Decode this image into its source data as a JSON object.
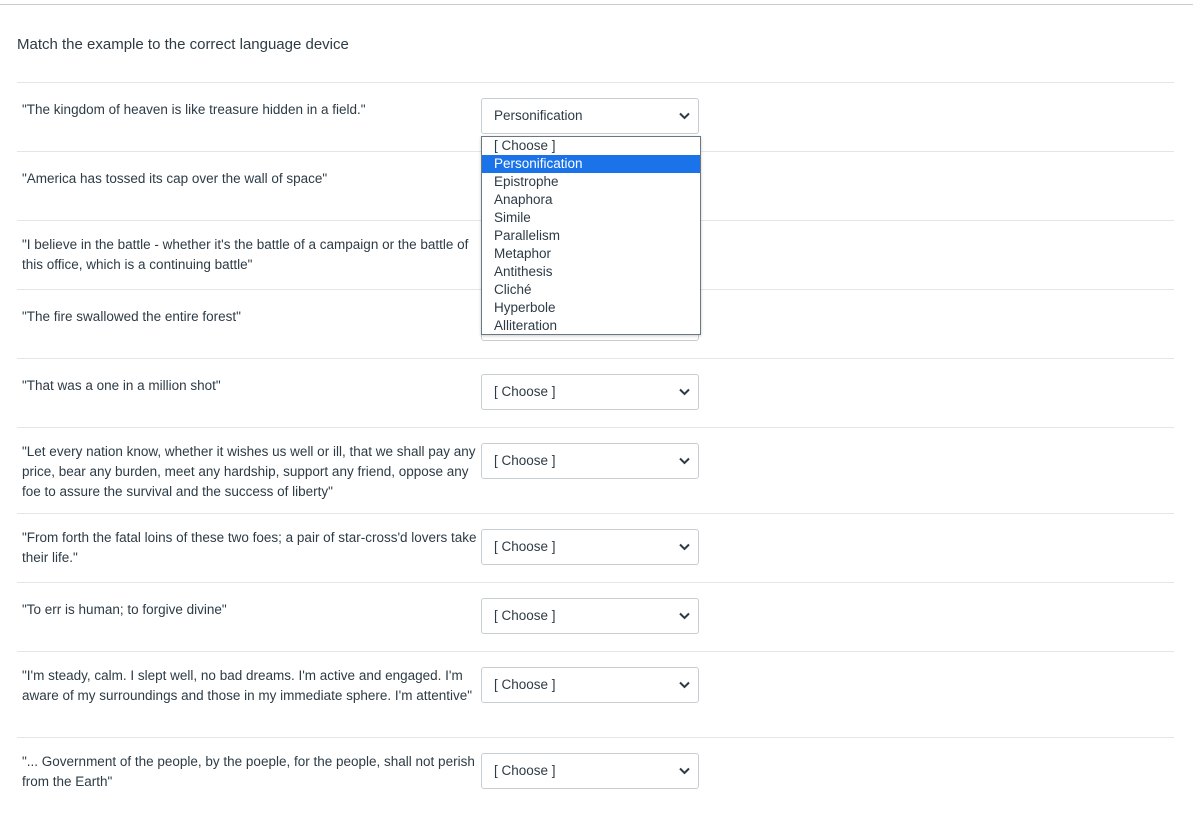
{
  "question": {
    "text": "Match the example to the correct language device"
  },
  "rows": [
    {
      "prompt": "\"The kingdom of heaven is like treasure hidden in a field.\"",
      "selected": "Personification"
    },
    {
      "prompt": "\"America has tossed its cap over the wall of space\"",
      "selected": ""
    },
    {
      "prompt": "\"I believe in the battle - whether it's the battle of a campaign or the battle of this office, which is a continuing battle\"",
      "selected": ""
    },
    {
      "prompt": "\"The fire swallowed the entire forest\"",
      "selected": ""
    },
    {
      "prompt": "\"That was a one in a million shot\"",
      "selected": "[ Choose ]"
    },
    {
      "prompt": "\"Let every nation know, whether it wishes us well or ill, that we shall pay any price, bear any burden, meet any hardship, support any friend, oppose any foe to assure the survival and the success of liberty\"",
      "selected": "[ Choose ]"
    },
    {
      "prompt": "\"From forth the fatal loins of these two foes; a pair of star-cross'd lovers take their life.\"",
      "selected": "[ Choose ]"
    },
    {
      "prompt": "\"To err is human; to forgive divine\"",
      "selected": "[ Choose ]"
    },
    {
      "prompt": "\"I'm steady, calm. I slept well, no bad dreams. I'm active and engaged. I'm aware of my surroundings and those in my immediate sphere. I'm attentive\"",
      "selected": "[ Choose ]"
    },
    {
      "prompt": "\"... Government of the people, by the poeple, for the people, shall not perish from the Earth\"",
      "selected": "[ Choose ]"
    }
  ],
  "dropdown": {
    "highlighted": "Personification",
    "options": [
      "[ Choose ]",
      "Personification",
      "Epistrophe",
      "Anaphora",
      "Simile",
      "Parallelism",
      "Metaphor",
      "Antithesis",
      "Cliché",
      "Hyperbole",
      "Alliteration"
    ]
  },
  "icons": {
    "chevron": "chevron-down-icon"
  },
  "colors": {
    "text": "#2d3b45",
    "highlight": "#1a73e8",
    "border": "#c7cdd1"
  }
}
